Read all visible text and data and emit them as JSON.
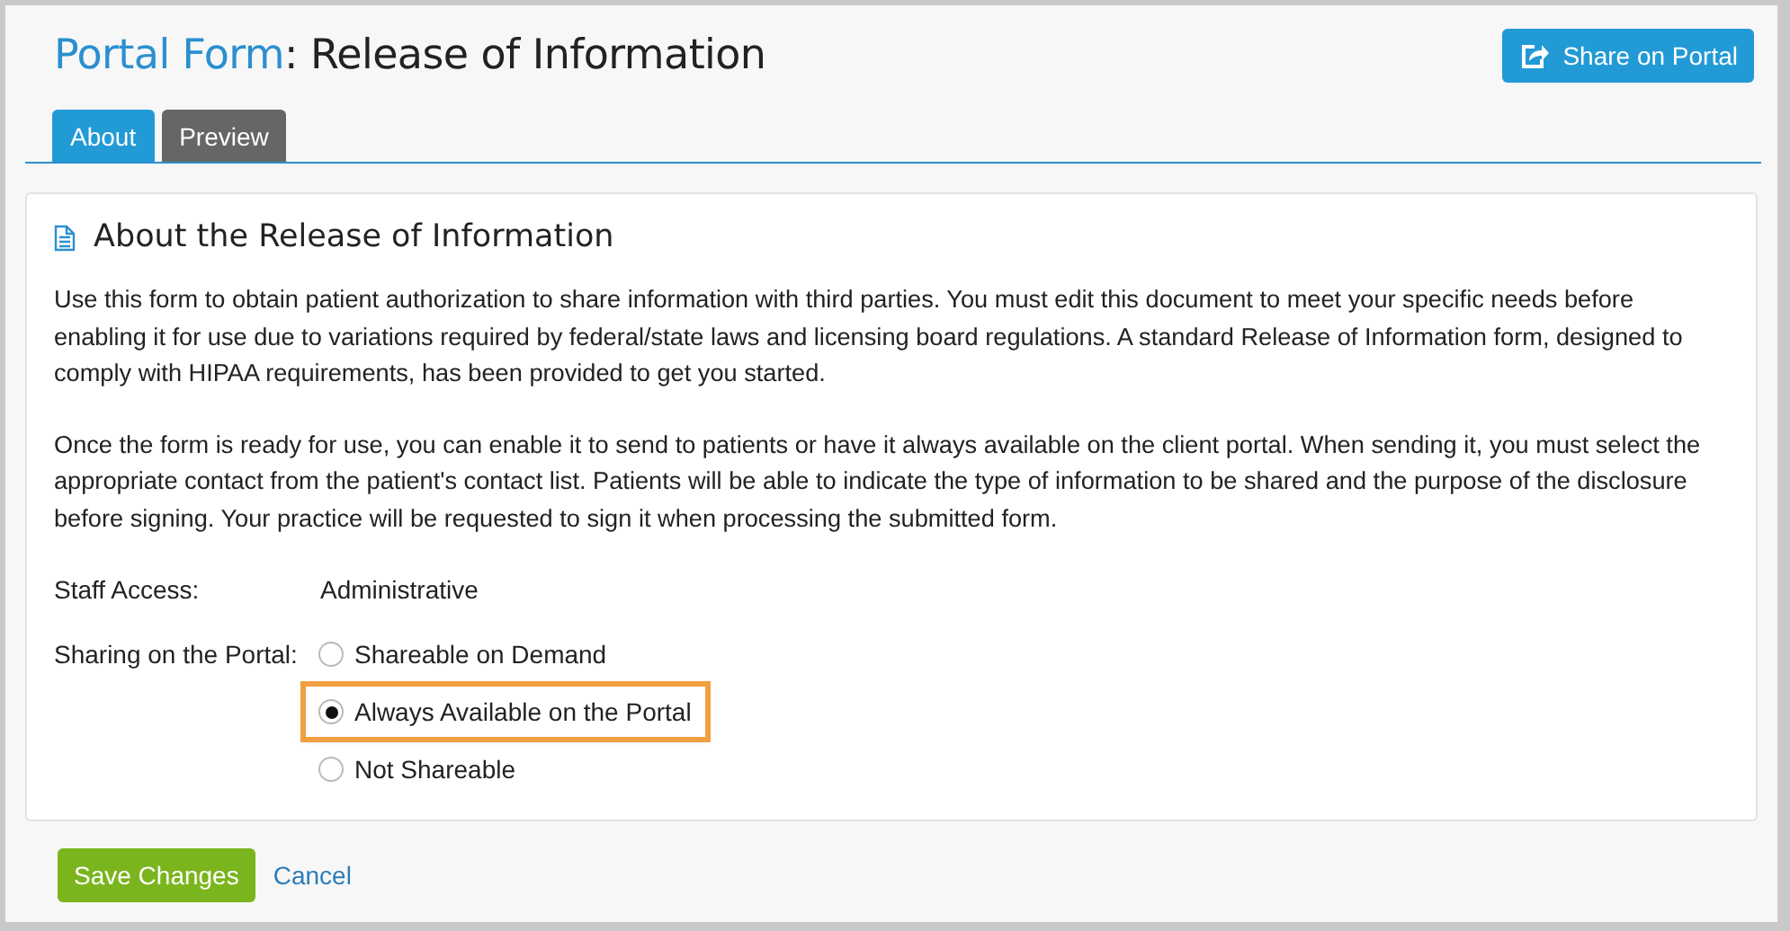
{
  "header": {
    "title_prefix": "Portal Form",
    "title": ": Release of Information",
    "share_button": "Share on Portal"
  },
  "tabs": [
    {
      "label": "About",
      "selected": true
    },
    {
      "label": "Preview",
      "selected": false
    }
  ],
  "card": {
    "heading": "About the Release of Information",
    "paragraphs": [
      "Use this form to obtain patient authorization to share information with third parties. You must edit this document to meet your specific needs before enabling it for use due to variations required by federal/state laws and licensing board regulations. A standard Release of Information form, designed to comply with HIPAA requirements, has been provided to get you started.",
      "Once the form is ready for use, you can enable it to send to patients or have it always available on the client portal. When sending it, you must select the appropriate contact from the patient's contact list. Patients will be able to indicate the type of information to be shared and the purpose of the disclosure before signing. Your practice will be requested to sign it when processing the submitted form."
    ],
    "staff_access": {
      "label": "Staff Access:",
      "value": "Administrative"
    },
    "sharing": {
      "label": "Sharing on the Portal:",
      "options": [
        {
          "label": "Shareable on Demand",
          "selected": false,
          "highlighted": false
        },
        {
          "label": "Always Available on the Portal",
          "selected": true,
          "highlighted": true
        },
        {
          "label": "Not Shareable",
          "selected": false,
          "highlighted": false
        }
      ]
    }
  },
  "actions": {
    "save": "Save Changes",
    "cancel": "Cancel"
  }
}
